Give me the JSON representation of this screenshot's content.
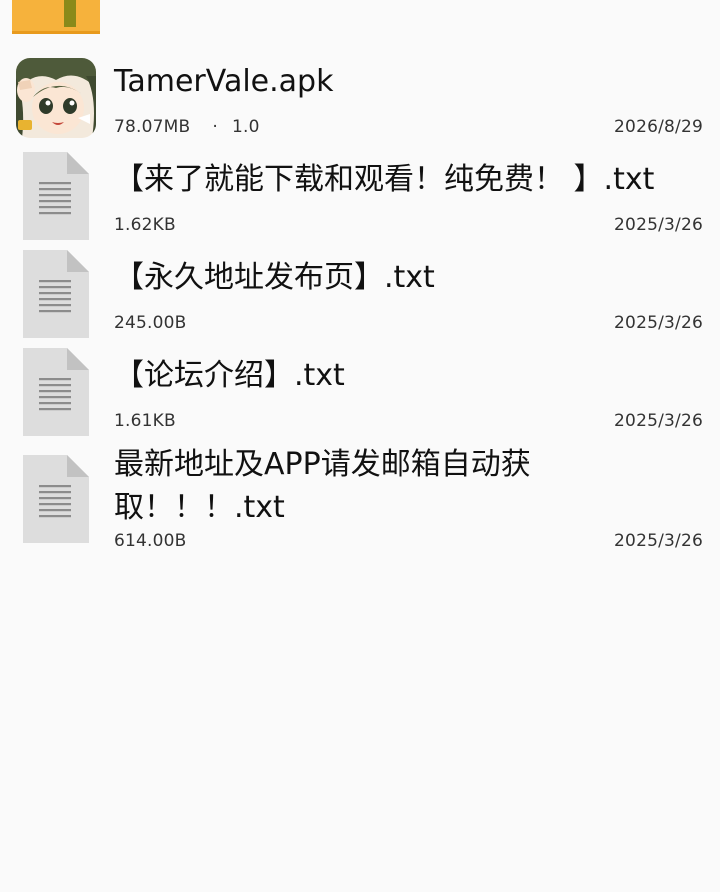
{
  "files": [
    {
      "name": "TamerVale.apk",
      "size": "78.07MB",
      "separator": "·",
      "version": "1.0",
      "date": "2026/8/29",
      "icon": "app-icon"
    },
    {
      "name": "【来了就能下载和观看！纯免费！ 】.txt",
      "size": "1.62KB",
      "date": "2025/3/26",
      "icon": "text-file-icon"
    },
    {
      "name": "【永久地址发布页】.txt",
      "size": "245.00B",
      "date": "2025/3/26",
      "icon": "text-file-icon"
    },
    {
      "name": "【论坛介绍】.txt",
      "size": "1.61KB",
      "date": "2025/3/26",
      "icon": "text-file-icon"
    },
    {
      "name": "最新地址及APP请发邮箱自动获取！！！.txt",
      "size": "614.00B",
      "date": "2025/3/26",
      "icon": "text-file-icon"
    }
  ],
  "colors": {
    "folder": "#f6b23c",
    "doc_icon": "#d9d9d9",
    "text": "#111111",
    "meta_text": "#333333",
    "background": "#fafafa"
  }
}
